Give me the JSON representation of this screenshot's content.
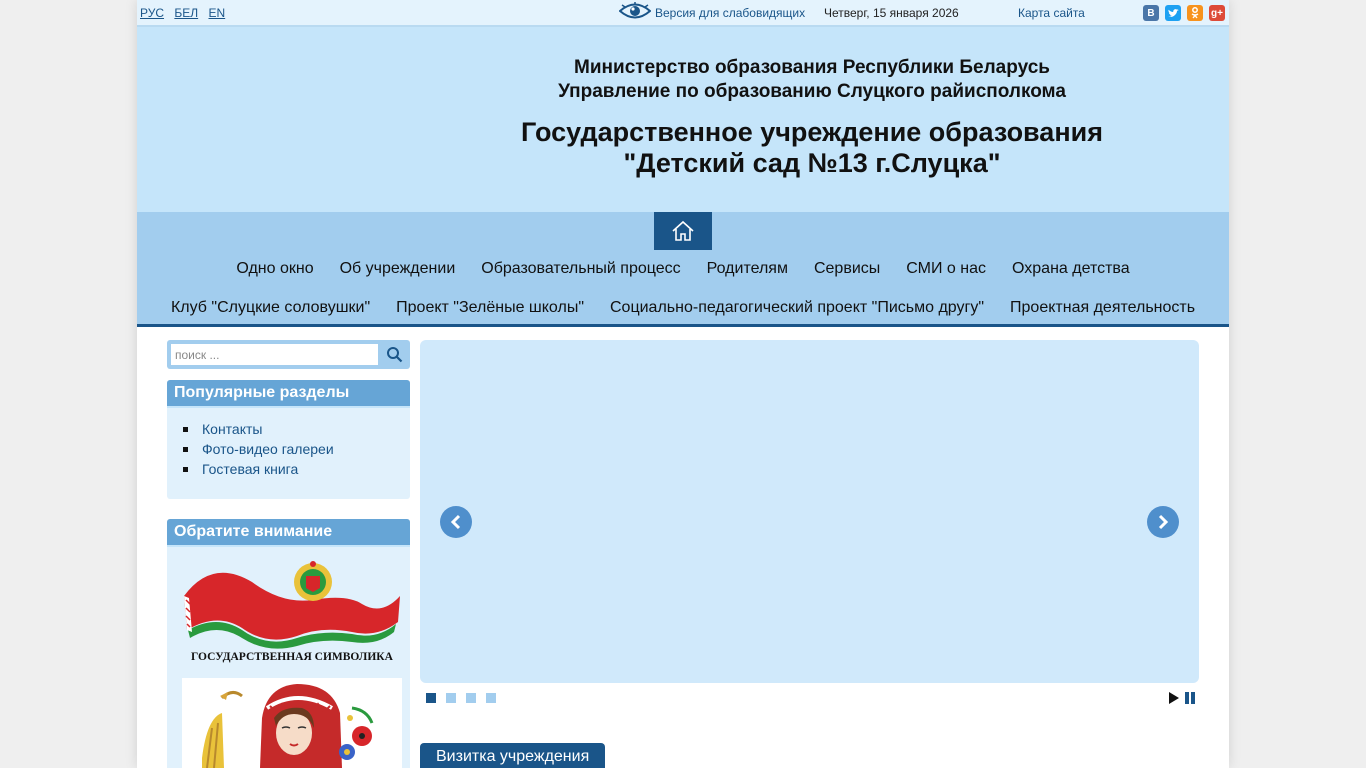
{
  "topbar": {
    "languages": [
      "РУС",
      "БЕЛ",
      "EN"
    ],
    "low_vision_label": "Версия для слабовидящих",
    "date": "Четверг, 15 января 2026",
    "sitemap_label": "Карта сайта",
    "socials": [
      {
        "name": "vkontakte",
        "glyph": "B",
        "color": "#4a76a8"
      },
      {
        "name": "twitter",
        "glyph": "t",
        "color": "#1da1f2"
      },
      {
        "name": "odnoklassniki",
        "glyph": "ok",
        "color": "#f7931e"
      },
      {
        "name": "google-plus",
        "glyph": "g+",
        "color": "#dd4b39"
      }
    ]
  },
  "header": {
    "ministry_line1": "Министерство образования Республики Беларусь",
    "ministry_line2": "Управление по образованию Слуцкого райисполкома",
    "institution_line1": "Государственное учреждение образования",
    "institution_line2": "\"Детский сад №13 г.Слуцка\""
  },
  "nav": {
    "row1": [
      "Одно окно",
      "Об учреждении",
      "Образовательный процесс",
      "Родителям",
      "Сервисы",
      "СМИ о нас",
      "Охрана детства"
    ],
    "row2": [
      "Клуб \"Слуцкие соловушки\"",
      "Проект \"Зелёные школы\"",
      "Социально-педагогический проект \"Письмо другу\"",
      "Проектная деятельность"
    ]
  },
  "search": {
    "placeholder": "поиск ..."
  },
  "popular": {
    "title": "Популярные разделы",
    "items": [
      "Контакты",
      "Фото-видео галереи",
      "Гостевая книга"
    ]
  },
  "attention": {
    "title": "Обратите внимание",
    "banner1_text": "ГОСУДАРСТВЕННАЯ СИМВОЛИКА"
  },
  "slider": {
    "slide_count": 4,
    "active_slide": 1
  },
  "content": {
    "tab_label": "Визитка учреждения"
  },
  "colors": {
    "primary": "#1a5589",
    "header_bg": "#c5e5fa",
    "nav_bg": "#a2cdee"
  }
}
